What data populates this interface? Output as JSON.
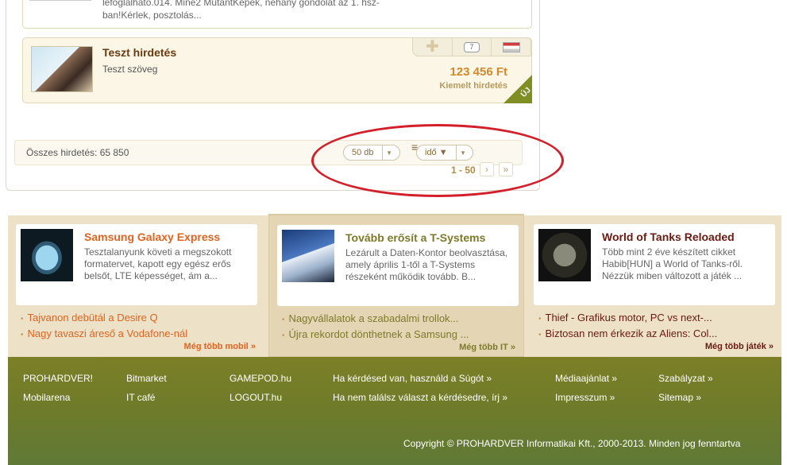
{
  "previous_ad": {
    "snippet_line1": "lefoglalható.014. Mine2 MutantKépek, néhány gondolat az 1. hsz-",
    "snippet_line2": "ban!Kérlek, posztolás..."
  },
  "ad": {
    "title": "Teszt hirdetés",
    "description": "Teszt szöveg",
    "price": "123 456 Ft",
    "featured_label": "Kiemelt hirdetés",
    "comment_count": "7",
    "new_badge": "ÚJ"
  },
  "summary": {
    "total_label": "Összes hirdetés: 65 850",
    "per_page": "50 db",
    "sort": "idő ▼",
    "page_range": "1 - 50"
  },
  "news": [
    {
      "title": "Samsung Galaxy Express",
      "text": "Tesztalanyunk követi a megszokott formatervet, kapott egy egész erős belsőt, LTE képességet, ám a...",
      "links": [
        "Tajvanon debütál a Desire Q",
        "Nagy tavaszi áreső a Vodafone-nál"
      ],
      "more": "Még több mobil »",
      "accent": "#e0641e"
    },
    {
      "title": "Tovább erősít a T-Systems",
      "text": "Lezárult a Daten-Kontor beolvasztása, amely április 1-től a T-Systems részeként működik tovább. B...",
      "links": [
        "Nagyvállalatok a szabadalmi trollok...",
        "Újra rekordot dönthetnek a Samsung ..."
      ],
      "more": "Még több IT »",
      "accent": "#7c7a2a"
    },
    {
      "title": "World of Tanks Reloaded",
      "text": "Több mint 2 éve készített cikket Habib[HUN] a World of Tanks-ről. Nézzük miben változott a játék ...",
      "links": [
        "Thief - Grafikus motor, PC vs next-...",
        "Biztosan nem érkezik az Aliens: Col..."
      ],
      "more": "Még több játék »",
      "accent": "#6a1a10"
    }
  ],
  "footer": {
    "col1": [
      "PROHARDVER!",
      "Mobilarena"
    ],
    "col2": [
      "Bitmarket",
      "IT café"
    ],
    "col3": [
      "GAMEPOD.hu",
      "LOGOUT.hu"
    ],
    "col4": [
      "Ha kérdésed van, használd a Súgót",
      "Ha nem találsz választ a kérdésedre, írj"
    ],
    "col5": [
      "Médiaajánlat",
      "Impresszum"
    ],
    "col6": [
      "Szabályzat",
      "Sitemap"
    ],
    "copyright": "Copyright © PROHARDVER Informatikai Kft., 2000-2013. Minden jog fenntartva"
  },
  "colors": {
    "annotation_ring": "#d31f2a",
    "footer_green": "#6e7b2a",
    "price_orange": "#d08a2c"
  }
}
